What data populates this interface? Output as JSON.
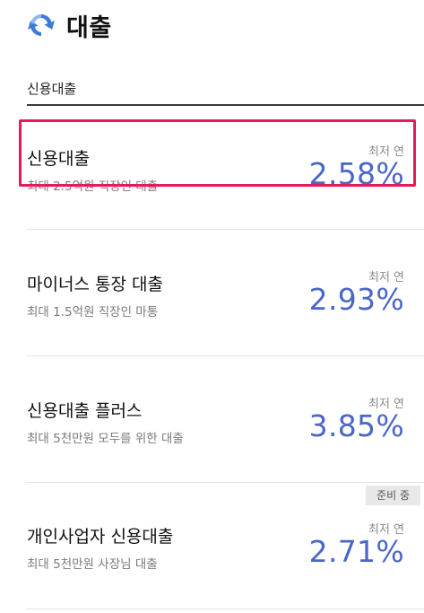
{
  "header": {
    "title": "대출",
    "logo_icon": "refresh-arrow-icon",
    "logo_color": "#3e7bd6"
  },
  "tab": {
    "label": "신용대출"
  },
  "loans": [
    {
      "name": "신용대출",
      "description": "최대 2.5억원 직장인 대출",
      "rate_label": "최저 연",
      "rate": "2.58%",
      "badge": ""
    },
    {
      "name": "마이너스 통장 대출",
      "description": "최대 1.5억원 직장인 마통",
      "rate_label": "최저 연",
      "rate": "2.93%",
      "badge": ""
    },
    {
      "name": "신용대출 플러스",
      "description": "최대 5천만원 모두를 위한 대출",
      "rate_label": "최저 연",
      "rate": "3.85%",
      "badge": ""
    },
    {
      "name": "개인사업자 신용대출",
      "description": "최대 5천만원 사장님 대출",
      "rate_label": "최저 연",
      "rate": "2.71%",
      "badge": "준비 중"
    }
  ],
  "colors": {
    "rate": "#4a66c8",
    "highlight": "#e8195a",
    "badge_bg": "#e8e8e8"
  }
}
